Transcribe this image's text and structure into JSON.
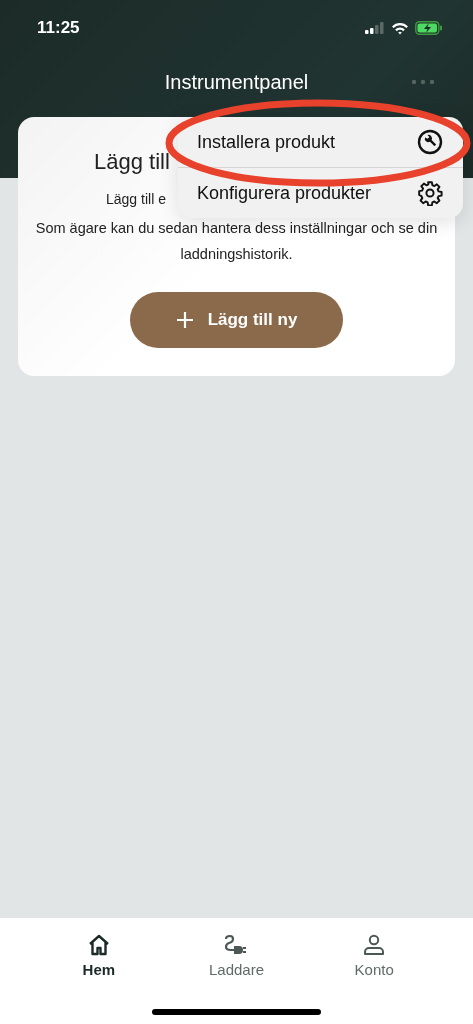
{
  "status_bar": {
    "time": "11:25"
  },
  "header": {
    "title": "Instrumentpanel"
  },
  "card": {
    "title": "Lägg till",
    "text_line_1": "Lägg till e",
    "text": "Som ägare kan du sedan hantera dess inställningar och se din laddningshistorik.",
    "button": "Lägg till ny"
  },
  "menu": {
    "items": [
      {
        "label": "Installera produkt",
        "kind": "wrench",
        "highlighted": true
      },
      {
        "label": "Konfigurera produkter",
        "kind": "gear",
        "highlighted": false
      }
    ]
  },
  "tab_bar": [
    {
      "label": "Hem",
      "kind": "home",
      "selected": true
    },
    {
      "label": "Laddare",
      "kind": "plug",
      "selected": false
    },
    {
      "label": "Konto",
      "kind": "person",
      "selected": false
    }
  ]
}
